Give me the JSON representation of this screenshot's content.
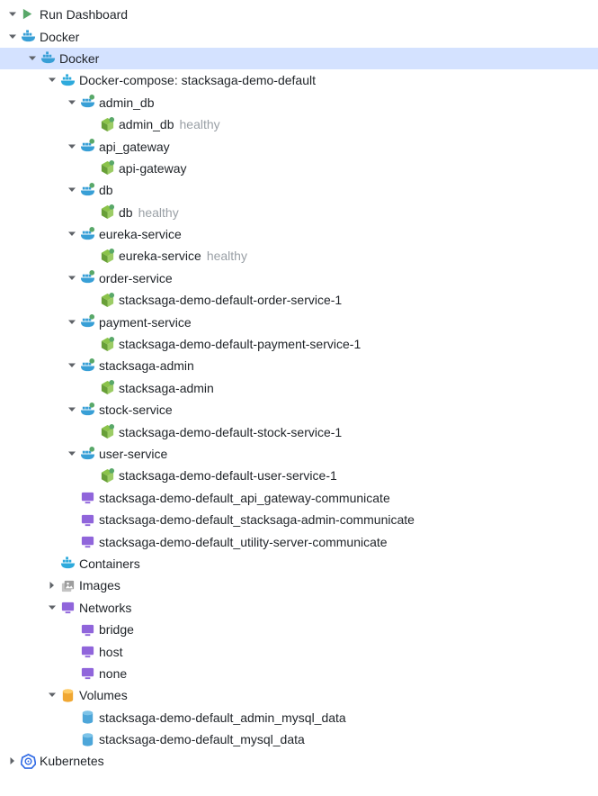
{
  "tree": {
    "run_dashboard": "Run Dashboard",
    "docker_root": "Docker",
    "docker_conn": "Docker",
    "compose": "Docker-compose: stacksaga-demo-default",
    "services": {
      "admin_db": {
        "name": "admin_db",
        "container": "admin_db",
        "status": "healthy"
      },
      "api_gateway": {
        "name": "api_gateway",
        "container": "api-gateway",
        "status": ""
      },
      "db": {
        "name": "db",
        "container": "db",
        "status": "healthy"
      },
      "eureka": {
        "name": "eureka-service",
        "container": "eureka-service",
        "status": "healthy"
      },
      "order": {
        "name": "order-service",
        "container": "stacksaga-demo-default-order-service-1",
        "status": ""
      },
      "payment": {
        "name": "payment-service",
        "container": "stacksaga-demo-default-payment-service-1",
        "status": ""
      },
      "stacksaga_admin": {
        "name": "stacksaga-admin",
        "container": "stacksaga-admin",
        "status": ""
      },
      "stock": {
        "name": "stock-service",
        "container": "stacksaga-demo-default-stock-service-1",
        "status": ""
      },
      "user": {
        "name": "user-service",
        "container": "stacksaga-demo-default-user-service-1",
        "status": ""
      }
    },
    "compose_networks": [
      "stacksaga-demo-default_api_gateway-communicate",
      "stacksaga-demo-default_stacksaga-admin-communicate",
      "stacksaga-demo-default_utility-server-communicate"
    ],
    "containers_label": "Containers",
    "images_label": "Images",
    "networks_label": "Networks",
    "networks": [
      "bridge",
      "host",
      "none"
    ],
    "volumes_label": "Volumes",
    "volumes": [
      "stacksaga-demo-default_admin_mysql_data",
      "stacksaga-demo-default_mysql_data"
    ],
    "kubernetes": "Kubernetes"
  }
}
